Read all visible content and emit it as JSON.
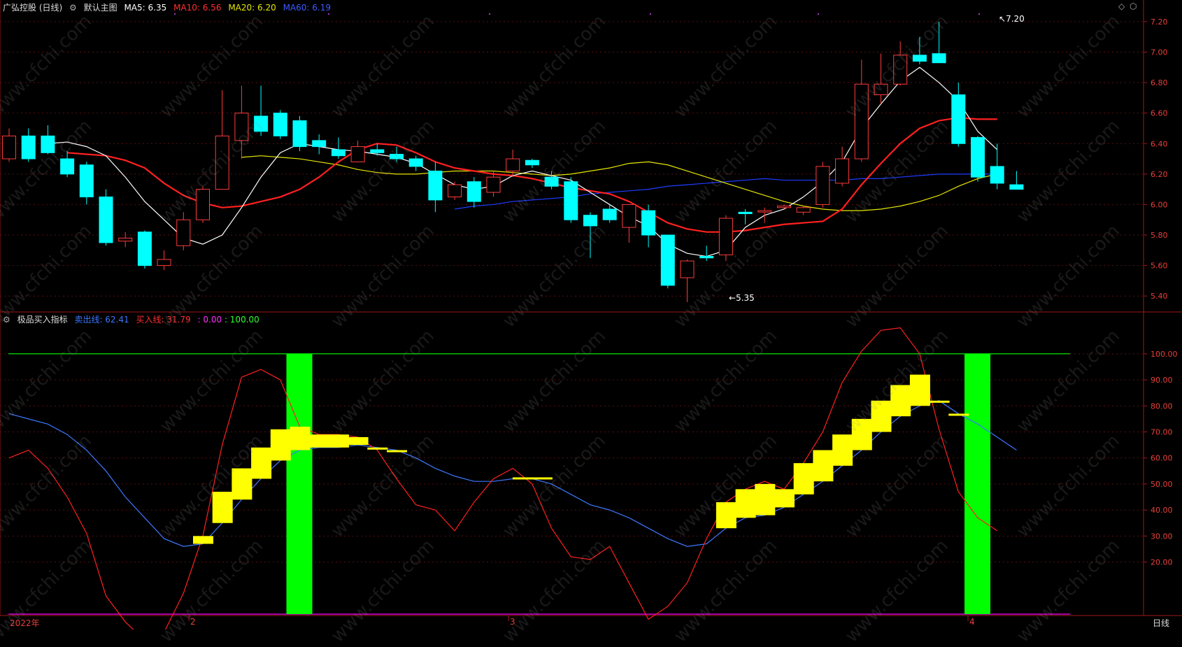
{
  "header": {
    "stock_title": "广弘控股 (日线)",
    "main_chart_label": "默认主图",
    "ma5": "MA5: 6.35",
    "ma10": "MA10: 6.56",
    "ma20": "MA20: 6.20",
    "ma60": "MA60: 6.19"
  },
  "indicator": {
    "name": "极品买入指标",
    "sell_line": "卖出线: 62.41",
    "buy_line": "买入线: 31.79",
    "v1": ": 0.00",
    "v2": ": 100.00"
  },
  "annotations": {
    "high": "7.20",
    "low": "5.35"
  },
  "x_axis": {
    "labels": [
      "2022年",
      "2",
      "3",
      "4"
    ],
    "period": "日线"
  },
  "watermark": "www.cfchi.com",
  "colors": {
    "up": "#ff3b3b",
    "down": "#00ffff",
    "ma5": "#ffffff",
    "ma10": "#ff2020",
    "ma20": "#e6e600",
    "ma60": "#1e3cff",
    "sell": "#3c78ff",
    "buy": "#ff2020",
    "green": "#00ff00",
    "magenta": "#ff00ff",
    "yellow": "#ffff00"
  },
  "chart_data": [
    {
      "type": "candlestick",
      "title": "广弘控股 (日线)",
      "ylim": [
        5.3,
        7.25
      ],
      "yticks": [
        "7.20",
        "7.00",
        "6.80",
        "6.60",
        "6.40",
        "6.20",
        "6.00",
        "5.80",
        "5.60",
        "5.40"
      ],
      "candles": [
        [
          6.3,
          6.45,
          6.5,
          6.28
        ],
        [
          6.45,
          6.3,
          6.5,
          6.28
        ],
        [
          6.45,
          6.34,
          6.52,
          6.33
        ],
        [
          6.3,
          6.2,
          6.35,
          6.18
        ],
        [
          6.26,
          6.05,
          6.28,
          6.0
        ],
        [
          6.05,
          5.75,
          6.1,
          5.73
        ],
        [
          5.76,
          5.78,
          5.82,
          5.72
        ],
        [
          5.82,
          5.6,
          5.83,
          5.58
        ],
        [
          5.6,
          5.64,
          5.7,
          5.57
        ],
        [
          5.73,
          5.9,
          5.95,
          5.7
        ],
        [
          5.9,
          6.1,
          6.12,
          5.88
        ],
        [
          6.1,
          6.45,
          6.75,
          6.1
        ],
        [
          6.42,
          6.6,
          6.78,
          6.3
        ],
        [
          6.58,
          6.48,
          6.78,
          6.45
        ],
        [
          6.6,
          6.45,
          6.62,
          6.43
        ],
        [
          6.55,
          6.38,
          6.58,
          6.35
        ],
        [
          6.42,
          6.38,
          6.46,
          6.33
        ],
        [
          6.36,
          6.32,
          6.44,
          6.3
        ],
        [
          6.28,
          6.38,
          6.42,
          6.28
        ],
        [
          6.36,
          6.34,
          6.4,
          6.32
        ],
        [
          6.33,
          6.3,
          6.38,
          6.28
        ],
        [
          6.3,
          6.25,
          6.32,
          6.22
        ],
        [
          6.22,
          6.03,
          6.28,
          5.95
        ],
        [
          6.05,
          6.13,
          6.15,
          6.03
        ],
        [
          6.15,
          6.02,
          6.18,
          5.98
        ],
        [
          6.08,
          6.18,
          6.22,
          6.05
        ],
        [
          6.22,
          6.3,
          6.36,
          6.18
        ],
        [
          6.29,
          6.26,
          6.3,
          6.24
        ],
        [
          6.18,
          6.12,
          6.22,
          6.1
        ],
        [
          6.15,
          5.9,
          6.18,
          5.88
        ],
        [
          5.93,
          5.86,
          5.95,
          5.65
        ],
        [
          5.97,
          5.9,
          6.0,
          5.88
        ],
        [
          5.85,
          6.0,
          6.0,
          5.75
        ],
        [
          5.96,
          5.8,
          6.0,
          5.72
        ],
        [
          5.8,
          5.47,
          5.8,
          5.45
        ],
        [
          5.52,
          5.63,
          5.64,
          5.36
        ],
        [
          5.66,
          5.65,
          5.73,
          5.63
        ],
        [
          5.67,
          5.91,
          5.93,
          5.63
        ],
        [
          5.95,
          5.94,
          5.97,
          5.87
        ],
        [
          5.96,
          5.96,
          5.98,
          5.88
        ],
        [
          5.98,
          5.99,
          6.0,
          5.97
        ],
        [
          5.95,
          5.98,
          5.99,
          5.93
        ],
        [
          6.0,
          6.25,
          6.28,
          5.98
        ],
        [
          6.14,
          6.3,
          6.38,
          6.12
        ],
        [
          6.3,
          6.79,
          6.95,
          6.28
        ],
        [
          6.72,
          6.79,
          6.99,
          6.66
        ],
        [
          6.79,
          6.98,
          7.07,
          6.78
        ],
        [
          6.98,
          6.94,
          7.1,
          6.92
        ],
        [
          6.99,
          6.93,
          7.2,
          6.93
        ],
        [
          6.72,
          6.4,
          6.8,
          6.38
        ],
        [
          6.44,
          6.18,
          6.45,
          6.15
        ],
        [
          6.25,
          6.14,
          6.4,
          6.1
        ],
        [
          6.13,
          6.1,
          6.22,
          6.1
        ]
      ],
      "ma5": [
        6.4,
        6.41,
        6.38,
        6.32,
        6.18,
        6.02,
        5.9,
        5.78,
        5.74,
        5.8,
        5.98,
        6.18,
        6.34,
        6.4,
        6.38,
        6.36,
        6.35,
        6.33,
        6.31,
        6.27,
        6.2,
        6.13,
        6.1,
        6.12,
        6.19,
        6.22,
        6.19,
        6.16,
        6.08,
        6.0,
        5.92,
        5.86,
        5.74,
        5.68,
        5.66,
        5.7,
        5.85,
        5.93,
        5.97,
        6.05,
        6.15,
        6.28,
        6.5,
        6.66,
        6.81,
        6.9,
        6.8,
        6.68,
        6.48,
        6.36
      ],
      "ma10": [
        6.34,
        6.33,
        6.32,
        6.29,
        6.24,
        6.14,
        6.06,
        6.01,
        5.98,
        5.99,
        6.02,
        6.05,
        6.1,
        6.18,
        6.28,
        6.36,
        6.4,
        6.39,
        6.34,
        6.28,
        6.24,
        6.22,
        6.2,
        6.19,
        6.17,
        6.14,
        6.11,
        6.09,
        6.07,
        6.02,
        5.95,
        5.88,
        5.84,
        5.82,
        5.82,
        5.83,
        5.85,
        5.87,
        5.88,
        5.89,
        5.97,
        6.13,
        6.27,
        6.4,
        6.5,
        6.55,
        6.57,
        6.56,
        6.56
      ],
      "ma20": [
        6.31,
        6.32,
        6.31,
        6.3,
        6.28,
        6.26,
        6.23,
        6.21,
        6.2,
        6.2,
        6.21,
        6.22,
        6.22,
        6.22,
        6.21,
        6.2,
        6.19,
        6.2,
        6.22,
        6.24,
        6.27,
        6.28,
        6.26,
        6.22,
        6.18,
        6.14,
        6.1,
        6.06,
        6.02,
        5.99,
        5.97,
        5.96,
        5.96,
        5.97,
        5.99,
        6.02,
        6.06,
        6.12,
        6.17,
        6.2
      ],
      "ma60": [
        5.97,
        5.99,
        6.0,
        6.02,
        6.03,
        6.04,
        6.05,
        6.07,
        6.08,
        6.09,
        6.1,
        6.12,
        6.13,
        6.14,
        6.15,
        6.16,
        6.17,
        6.16,
        6.16,
        6.16,
        6.16,
        6.17,
        6.17,
        6.18,
        6.19,
        6.2,
        6.2,
        6.2,
        6.2
      ]
    },
    {
      "type": "line",
      "title": "极品买入指标",
      "ylim": [
        0,
        115
      ],
      "yticks": [
        "100.00",
        "90.00",
        "80.00",
        "70.00",
        "60.00",
        "50.00",
        "40.00",
        "30.00",
        "20.00"
      ],
      "series": [
        {
          "name": "卖出线",
          "values": [
            77,
            75,
            73,
            69,
            63,
            55,
            45,
            37,
            29,
            26,
            27,
            35,
            44,
            52,
            59,
            63,
            64,
            64,
            65,
            64,
            63,
            60,
            56,
            53,
            51,
            51,
            52,
            52,
            50,
            46,
            42,
            40,
            37,
            33,
            29,
            26,
            27,
            33,
            37,
            38,
            41,
            46,
            51,
            57,
            63,
            70,
            76,
            80,
            82,
            77,
            73,
            68,
            63
          ]
        },
        {
          "name": "买入线",
          "values": [
            60,
            63,
            56,
            45,
            31,
            7,
            -3,
            -10,
            -7,
            8,
            30,
            65,
            91,
            94,
            90,
            72,
            69,
            69,
            68,
            63,
            52,
            42,
            40,
            32,
            43,
            52,
            56,
            50,
            33,
            22,
            21,
            26,
            12,
            -2,
            3,
            12,
            29,
            43,
            48,
            51,
            48,
            58,
            70,
            89,
            101,
            109,
            110,
            100,
            71,
            47,
            37,
            32
          ]
        }
      ],
      "buy_signals": [
        {
          "from": 10,
          "to": 20
        },
        {
          "from": 37,
          "to": 49
        }
      ],
      "green_bars": [
        15,
        50
      ],
      "green_line": 100,
      "magenta_line": 0
    }
  ]
}
